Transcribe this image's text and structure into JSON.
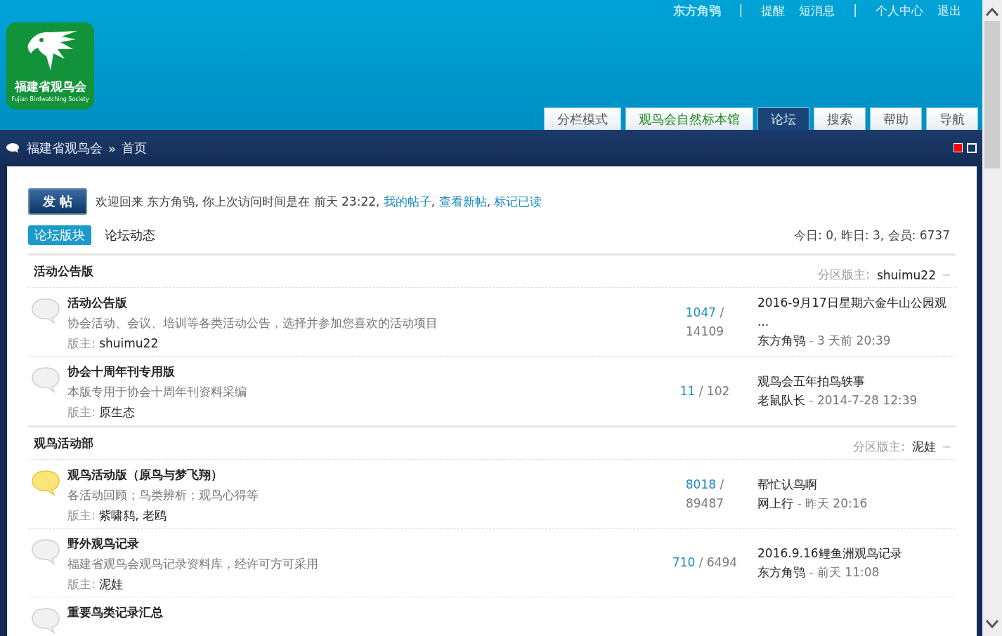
{
  "logo": {
    "title": "福建省观鸟会",
    "subtitle": "Fujian Birdwatching Society"
  },
  "top_links": [
    {
      "kind": "user",
      "label": "东方角鸮"
    },
    {
      "kind": "sep",
      "label": "|"
    },
    {
      "kind": "link",
      "label": "提醒"
    },
    {
      "kind": "link",
      "label": "短消息"
    },
    {
      "kind": "sep",
      "label": "|"
    },
    {
      "kind": "link",
      "label": "个人中心"
    },
    {
      "kind": "link",
      "label": "退出"
    }
  ],
  "nav_tabs": [
    {
      "label": "分栏模式",
      "selected": false
    },
    {
      "label": "观鸟会自然标本馆",
      "selected": false,
      "color": "#1e8a1e"
    },
    {
      "label": "论坛",
      "selected": true
    },
    {
      "label": "搜索",
      "selected": false
    },
    {
      "label": "帮助",
      "selected": false
    },
    {
      "label": "导航",
      "selected": false
    }
  ],
  "breadcrumb": {
    "items": [
      "福建省观鸟会",
      "首页"
    ],
    "separator": "»"
  },
  "post_button": "发 帖",
  "welcome": {
    "text": "欢迎回来 东方角鸮, 你上次访问时间是在 前天 23:22,",
    "links": [
      "我的帖子",
      "查看新帖",
      "标记已读"
    ],
    "separator": ","
  },
  "sub_tabs": [
    {
      "label": "论坛版块",
      "selected": true
    },
    {
      "label": "论坛动态",
      "selected": false
    }
  ],
  "stats": "今日: 0, 昨日: 3, 会员: 6737",
  "sections": [
    {
      "title": "活动公告版",
      "moderator_label": "分区版主:",
      "moderator": "shuimu22",
      "forums": [
        {
          "title": "活动公告版",
          "new": false,
          "description": "协会活动、会议、培训等各类活动公告，选择并参加您喜欢的活动项目",
          "moderator_label": "版主:",
          "moderators": "shuimu22",
          "threads": "1047",
          "separator": "/",
          "posts": "14109",
          "last_title": "2016-9月17日星期六金牛山公园观 ...",
          "last_author": "东方角鸮",
          "last_dash": "-",
          "last_time": "3 天前 20:39"
        },
        {
          "title": "协会十周年刊专用版",
          "new": false,
          "description": "本版专用于协会十周年刊资料采编",
          "moderator_label": "版主:",
          "moderators": "原生态",
          "threads": "11",
          "separator": "/",
          "posts": "102",
          "last_title": "观鸟会五年拍鸟轶事",
          "last_author": "老鼠队长",
          "last_dash": "-",
          "last_time": "2014-7-28 12:39"
        }
      ]
    },
    {
      "title": "观鸟活动部",
      "moderator_label": "分区版主:",
      "moderator": "泥娃",
      "forums": [
        {
          "title": "观鸟活动版（原鸟与梦飞翔）",
          "new": true,
          "description": "各活动回顾；鸟类辨析；观鸟心得等",
          "moderator_label": "版主:",
          "moderators": "紫啸鸫, 老鸥",
          "threads": "8018",
          "separator": "/",
          "posts": "89487",
          "last_title": "帮忙认鸟啊",
          "last_author": "网上行",
          "last_dash": "-",
          "last_time": "昨天 20:16"
        },
        {
          "title": "野外观鸟记录",
          "new": false,
          "description": "福建省观鸟会观鸟记录资料库，经许可方可采用",
          "moderator_label": "版主:",
          "moderators": "泥娃",
          "threads": "710",
          "separator": "/",
          "posts": "6494",
          "last_title": "2016.9.16鲤鱼洲观鸟记录",
          "last_author": "东方角鸮",
          "last_dash": "-",
          "last_time": "前天 11:08"
        },
        {
          "title": "重要鸟类记录汇总",
          "new": false
        }
      ]
    }
  ]
}
